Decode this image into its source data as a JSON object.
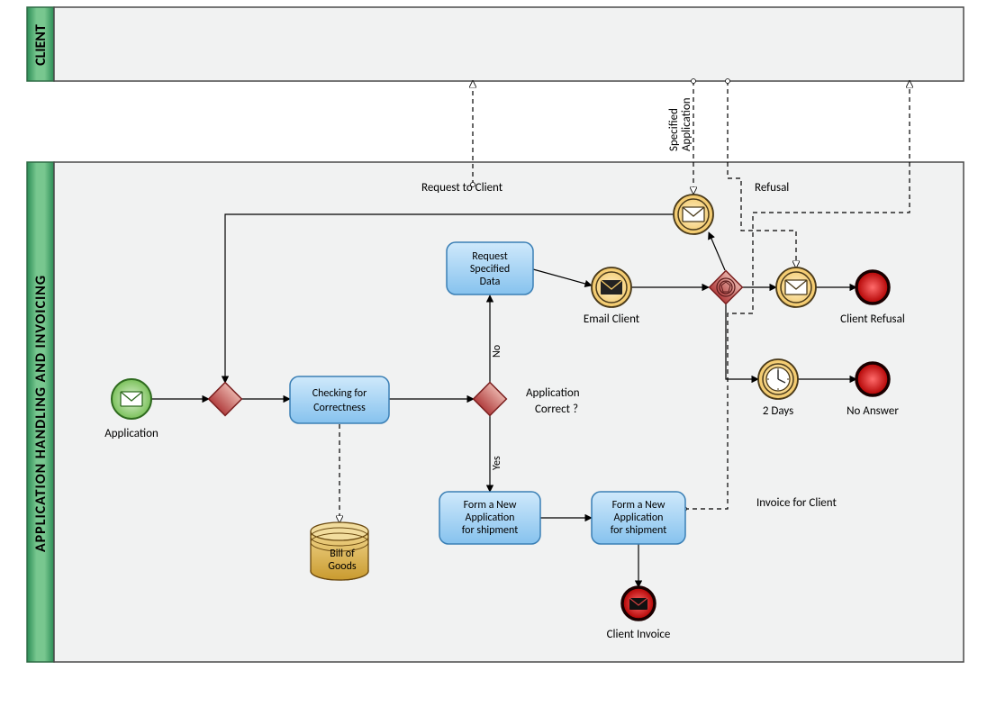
{
  "pools": {
    "client": {
      "title": "CLIENT"
    },
    "main": {
      "title": "APPLICATION HANDLING AND INVOICING"
    }
  },
  "tasks": {
    "checking": {
      "label": "Checking for Correctness"
    },
    "request": {
      "label": "Request Specified Data"
    },
    "form1": {
      "label": "Form a New Application for shipment"
    },
    "form2": {
      "label": "Form a New Application for shipment"
    }
  },
  "events": {
    "start": {
      "label": "Application"
    },
    "email_client": {
      "label": "Email Client"
    },
    "client_refusal": {
      "label": "Client Refusal"
    },
    "no_answer": {
      "label": "No Answer"
    },
    "client_invoice": {
      "label": "Client Invoice"
    },
    "two_days": {
      "label": "2 Days"
    }
  },
  "data": {
    "bill": {
      "label": "Bill of Goods"
    }
  },
  "questions": {
    "correct": {
      "label": "Application Correct ?"
    }
  },
  "messages": {
    "request_to_client": {
      "label": "Request to Client"
    },
    "specified_app": {
      "label": "Specified Application"
    },
    "refusal": {
      "label": "Refusal"
    },
    "invoice": {
      "label": "Invoice for Client"
    }
  },
  "flow_labels": {
    "no": "No",
    "yes": "Yes"
  },
  "colors": {
    "green_grad_a": "#5bb37b",
    "green_grad_b": "#2a8c55",
    "lane_border": "#4a4a4a",
    "lane_fill": "#f1f2f2",
    "task_fill_a": "#bde0f7",
    "task_fill_b": "#74b9e8",
    "task_border": "#3a7fb5",
    "gateway_a": "#d98f8f",
    "gateway_b": "#b23b3b",
    "gateway_border": "#7a1f1f",
    "start_fill_a": "#c5e6b7",
    "start_fill_b": "#7bc15b",
    "start_border": "#2f6b1f",
    "inter_fill_a": "#ffe6a8",
    "inter_fill_b": "#f2c766",
    "inter_border": "#4a3a1a",
    "end_fill_a": "#ff5b5b",
    "end_fill_b": "#c00000",
    "end_border": "#1a0000",
    "data_a": "#e8c56b",
    "data_b": "#c99a2f",
    "data_border": "#6b4a10"
  },
  "chart_data": {
    "type": "table",
    "title": "BPMN Process — Application Handling and Invoicing",
    "pools": [
      "CLIENT",
      "APPLICATION HANDLING AND INVOICING"
    ],
    "elements": [
      {
        "id": "start",
        "type": "start-event-message",
        "pool": "APPLICATION HANDLING AND INVOICING",
        "label": "Application"
      },
      {
        "id": "gw_merge",
        "type": "exclusive-gateway",
        "pool": "APPLICATION HANDLING AND INVOICING",
        "label": ""
      },
      {
        "id": "checking",
        "type": "task",
        "pool": "APPLICATION HANDLING AND INVOICING",
        "label": "Checking for Correctness"
      },
      {
        "id": "bill",
        "type": "data-store",
        "pool": "APPLICATION HANDLING AND INVOICING",
        "label": "Bill of Goods"
      },
      {
        "id": "gw_correct",
        "type": "exclusive-gateway",
        "pool": "APPLICATION HANDLING AND INVOICING",
        "label": "Application Correct ?"
      },
      {
        "id": "request",
        "type": "task",
        "pool": "APPLICATION HANDLING AND INVOICING",
        "label": "Request Specified Data"
      },
      {
        "id": "email",
        "type": "intermediate-throw-message",
        "pool": "APPLICATION HANDLING AND INVOICING",
        "label": "Email Client"
      },
      {
        "id": "catch_spec",
        "type": "intermediate-catch-message",
        "pool": "APPLICATION HANDLING AND INVOICING",
        "label": ""
      },
      {
        "id": "gw_event",
        "type": "event-based-gateway",
        "pool": "APPLICATION HANDLING AND INVOICING",
        "label": ""
      },
      {
        "id": "refusal_msg",
        "type": "intermediate-catch-message",
        "pool": "APPLICATION HANDLING AND INVOICING",
        "label": ""
      },
      {
        "id": "two_days",
        "type": "intermediate-timer",
        "pool": "APPLICATION HANDLING AND INVOICING",
        "label": "2 Days"
      },
      {
        "id": "end_refusal",
        "type": "end-event",
        "pool": "APPLICATION HANDLING AND INVOICING",
        "label": "Client Refusal"
      },
      {
        "id": "end_noanswer",
        "type": "end-event",
        "pool": "APPLICATION HANDLING AND INVOICING",
        "label": "No Answer"
      },
      {
        "id": "form1",
        "type": "task",
        "pool": "APPLICATION HANDLING AND INVOICING",
        "label": "Form a New Application for shipment"
      },
      {
        "id": "form2",
        "type": "task",
        "pool": "APPLICATION HANDLING AND INVOICING",
        "label": "Form a New Application for shipment"
      },
      {
        "id": "end_invoice",
        "type": "end-event-message",
        "pool": "APPLICATION HANDLING AND INVOICING",
        "label": "Client Invoice"
      }
    ],
    "sequence_flows": [
      {
        "from": "start",
        "to": "gw_merge"
      },
      {
        "from": "gw_merge",
        "to": "checking"
      },
      {
        "from": "checking",
        "to": "gw_correct"
      },
      {
        "from": "gw_correct",
        "to": "request",
        "label": "No"
      },
      {
        "from": "gw_correct",
        "to": "form1",
        "label": "Yes"
      },
      {
        "from": "request",
        "to": "email"
      },
      {
        "from": "email",
        "to": "gw_event"
      },
      {
        "from": "gw_event",
        "to": "catch_spec"
      },
      {
        "from": "gw_event",
        "to": "refusal_msg"
      },
      {
        "from": "gw_event",
        "to": "two_days"
      },
      {
        "from": "catch_spec",
        "to": "gw_merge"
      },
      {
        "from": "refusal_msg",
        "to": "end_refusal"
      },
      {
        "from": "two_days",
        "to": "end_noanswer"
      },
      {
        "from": "form1",
        "to": "form2"
      },
      {
        "from": "form2",
        "to": "end_invoice"
      }
    ],
    "message_flows": [
      {
        "from": "email",
        "to": "CLIENT",
        "label": "Request to Client"
      },
      {
        "from": "CLIENT",
        "to": "catch_spec",
        "label": "Specified Application"
      },
      {
        "from": "CLIENT",
        "to": "refusal_msg",
        "label": "Refusal"
      },
      {
        "from": "form2",
        "to": "CLIENT",
        "label": "Invoice for Client"
      }
    ],
    "data_associations": [
      {
        "from": "checking",
        "to": "bill"
      }
    ]
  }
}
